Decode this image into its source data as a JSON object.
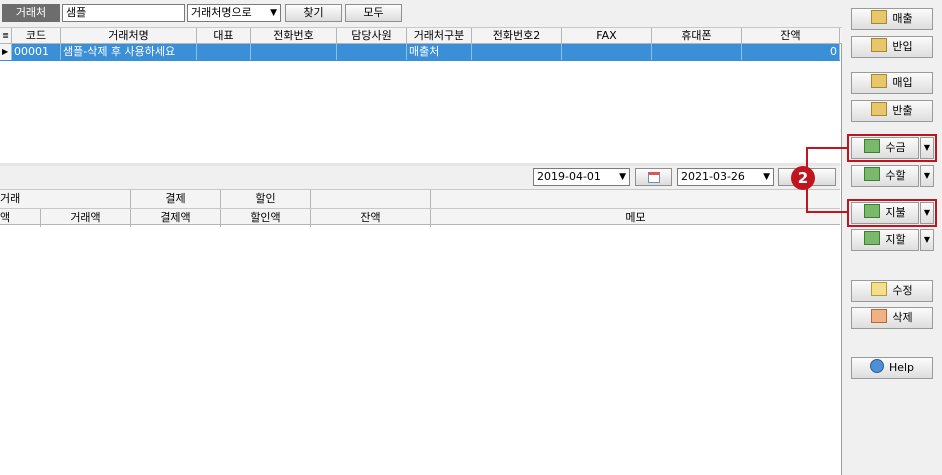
{
  "search": {
    "label": "거래처",
    "value": "샘플",
    "field_select": "거래처명으로",
    "find_label": "찾기",
    "all_label": "모두"
  },
  "grid": {
    "headers": [
      "코드",
      "거래처명",
      "대표",
      "전화번호",
      "담당사원",
      "거래처구분",
      "전화번호2",
      "FAX",
      "휴대폰",
      "잔액"
    ],
    "rows": [
      {
        "code": "00001",
        "name": "샘플-삭제 후 사용하세요",
        "rep": "",
        "phone": "",
        "staff": "",
        "type": "매출처",
        "phone2": "",
        "fax": "",
        "mobile": "",
        "balance": "0"
      }
    ]
  },
  "dates": {
    "from": "2019-04-01",
    "to": "2021-03-26"
  },
  "ledger": {
    "group_headers": [
      "거래",
      "결제",
      "할인"
    ],
    "sub_headers": [
      "액",
      "거래액",
      "결제액",
      "할인액",
      "잔액",
      "메모"
    ]
  },
  "side": {
    "sales": "매출",
    "return_in": "반입",
    "purchase": "매입",
    "return_out": "반출",
    "collect": "수금",
    "collect_discount": "수할",
    "payment": "지불",
    "payment_discount": "지할",
    "edit": "수정",
    "delete": "삭제",
    "help": "Help"
  },
  "annotation": {
    "badge": "2"
  },
  "colors": {
    "selection": "#3a8fd6",
    "highlight": "#c0141e"
  }
}
